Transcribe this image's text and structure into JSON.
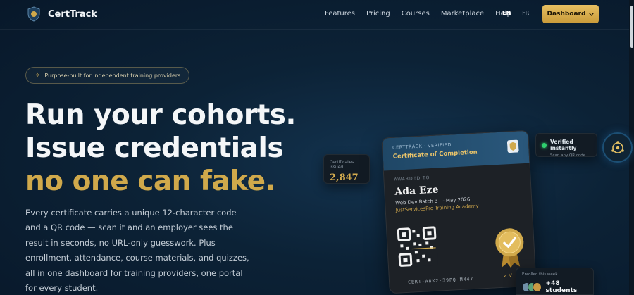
{
  "nav": {
    "brand": "CertTrack",
    "links": [
      "Features",
      "Pricing",
      "Courses",
      "Marketplace",
      "Help"
    ],
    "languages": [
      "EN",
      "FR"
    ],
    "active_language": "EN",
    "dashboard_label": "Dashboard"
  },
  "hero": {
    "badge": "Purpose-built for independent training providers",
    "headline_line1": "Run your cohorts.",
    "headline_line2": "Issue credentials",
    "headline_line3": "no one can fake.",
    "body": "Every certificate carries a unique 12-character code and a QR code — scan it and an employer sees the result in seconds, no URL-only guesswork. Plus enrollment, attendance, course materials, and quizzes, all in one dashboard for training providers, one portal for every student."
  },
  "certificate": {
    "brand_line": "CERTTRACK · VERIFIED",
    "title": "Certificate of Completion",
    "awarded_label": "AWARDED TO",
    "recipient": "Ada Eze",
    "course": "Web Dev Batch 3 — May 2026",
    "academy": "JustServicesPro Training Academy",
    "code": "CERT-A8K2-39PQ-MN47",
    "verified_mark": "✓ V"
  },
  "chips": {
    "issued_label": "Certificates issued",
    "issued_value": "2,847",
    "verified_title": "Verified instantly",
    "verified_sub": "Scan any QR code",
    "enrolled_label": "Enrolled this week",
    "enrolled_count": "+48 students"
  },
  "colors": {
    "accent_gold": "#d0a94b",
    "verified_green": "#2fcf6e",
    "background": "#0c2236"
  },
  "icons": {
    "brand": "shield-icon",
    "badge": "sparkle-icon",
    "dashboard_caret": "chevron-down-icon",
    "fab": "target-icon"
  }
}
